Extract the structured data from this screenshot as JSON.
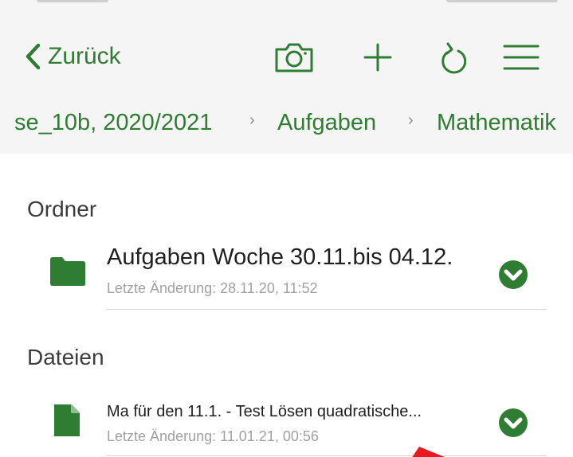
{
  "nav": {
    "back_label": "Zurück",
    "icons": [
      "camera-icon",
      "plus-icon",
      "refresh-icon",
      "menu-icon"
    ]
  },
  "breadcrumbs": {
    "items": [
      "se_10b, 2020/2021",
      "Aufgaben",
      "Mathematik"
    ],
    "separator": "›"
  },
  "sections": {
    "folders": {
      "title": "Ordner",
      "items": [
        {
          "name": "Aufgaben Woche 30.11.bis 04.12.",
          "modified": "Letzte Änderung: 28.11.20, 11:52",
          "icon": "folder-icon",
          "synced": true
        }
      ]
    },
    "files": {
      "title": "Dateien",
      "items": [
        {
          "name": "Ma für den 11.1. - Test Lösen quadratische...",
          "modified": "Letzte Änderung: 11.01.21, 00:56",
          "icon": "document-icon",
          "synced": true
        }
      ]
    }
  },
  "colors": {
    "accent": "#2f7d32",
    "background_top": "#f5f5f5",
    "secondary_text": "#a1a1a1",
    "annotation_arrow": "#e8191f"
  }
}
